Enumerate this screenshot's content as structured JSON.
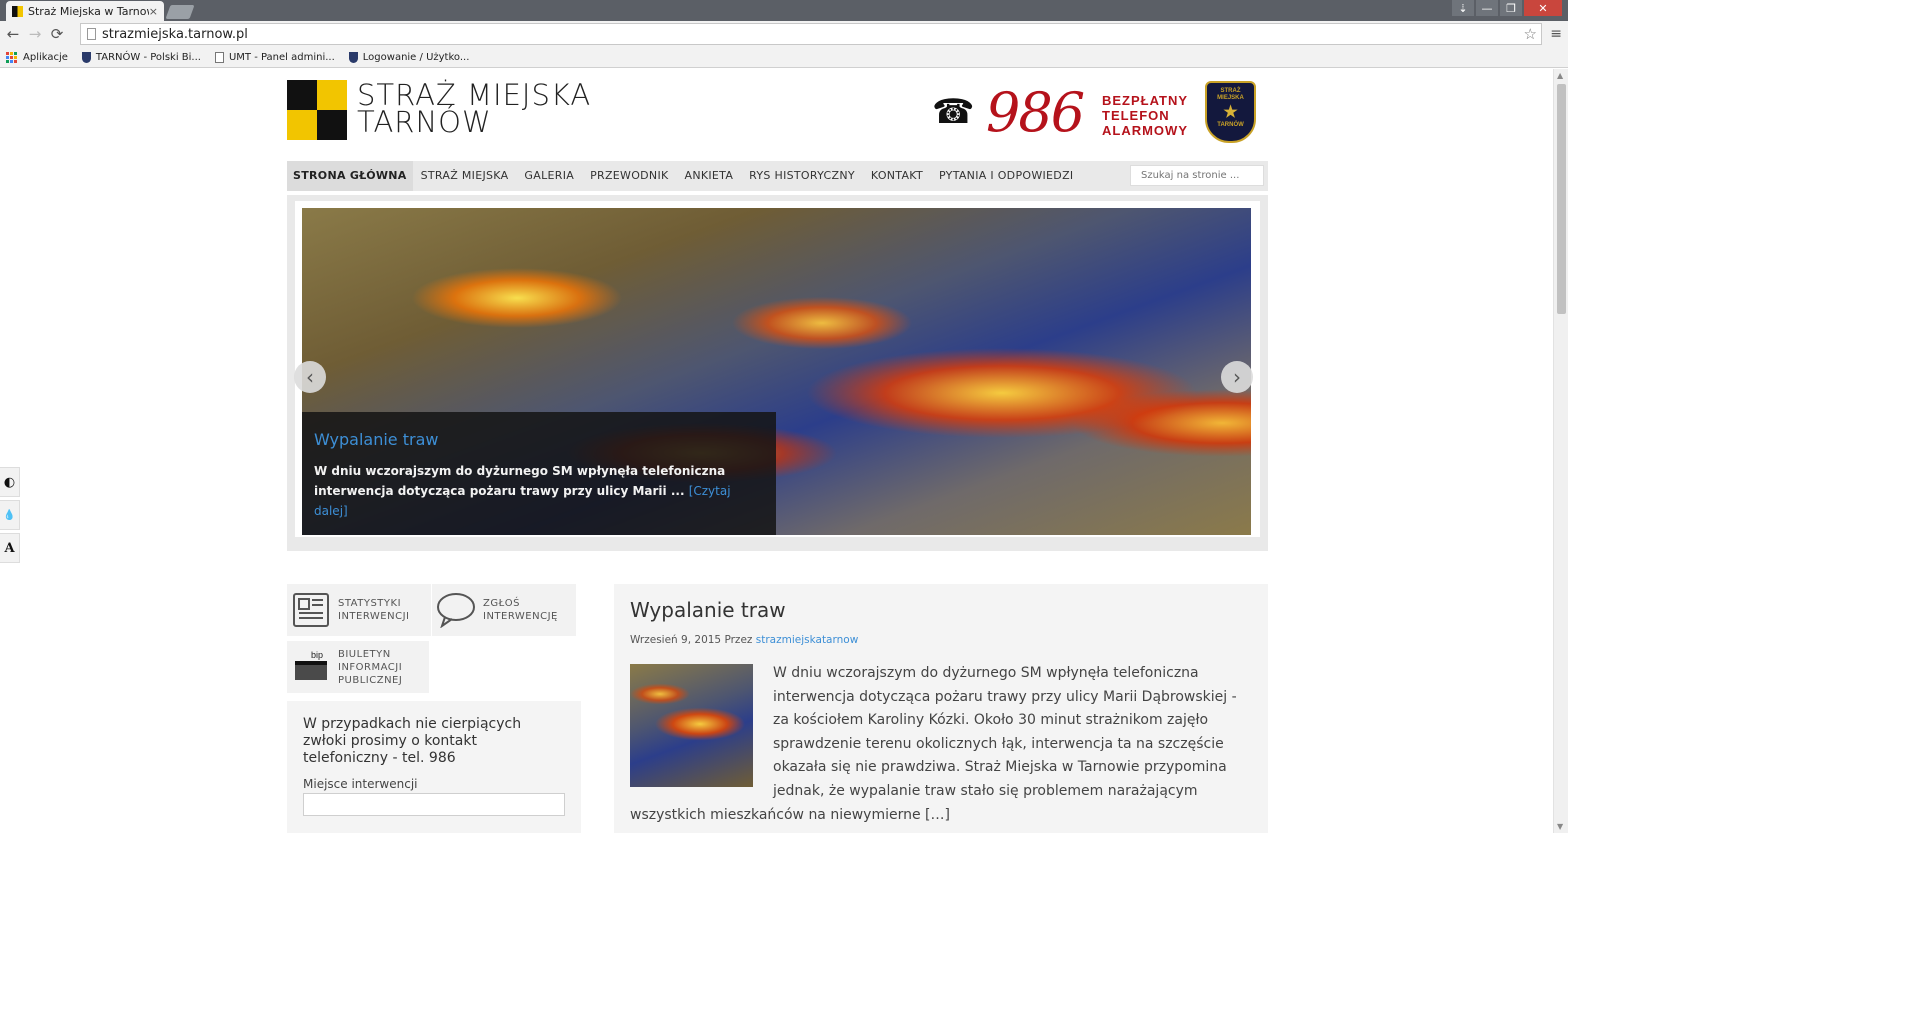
{
  "browser": {
    "tab_title": "Straż Miejska w Tarnowie",
    "tab_close": "×",
    "window_controls": [
      "⇣",
      "—",
      "❐",
      "✕"
    ],
    "nav": {
      "back": "←",
      "forward": "→",
      "reload": "⟳"
    },
    "url": "strazmiejska.tarnow.pl",
    "star": "☆",
    "menu": "≡",
    "bookmarks": [
      "Aplikacje",
      "TARNÓW - Polski Bi...",
      "UMT - Panel admini...",
      "Logowanie / Użytko..."
    ]
  },
  "colors": {
    "accent": "#3d8fd6",
    "alarm_red": "#b5121b",
    "logo_yellow": "#f2c500",
    "logo_black": "#111111"
  },
  "header": {
    "logo_line1": "STRAŻ MIEJSKA",
    "logo_line2": "TARNÓW",
    "phone_icon": "phone-icon",
    "alarm_number": "986",
    "alarm_words": [
      "BEZPŁATNY",
      "TELEFON",
      "ALARMOWY"
    ],
    "badge_top": "STRAŻ MIEJSKA",
    "badge_bottom": "TARNÓW"
  },
  "menu": {
    "items": [
      "STRONA GŁÓWNA",
      "STRAŻ MIEJSKA",
      "GALERIA",
      "PRZEWODNIK",
      "ANKIETA",
      "RYS HISTORYCZNY",
      "KONTAKT",
      "PYTANIA I ODPOWIEDZI"
    ],
    "search_placeholder": "Szukaj na stronie ..."
  },
  "slider": {
    "title": "Wypalanie traw",
    "text": "W dniu wczorajszym do dyżurnego SM wpłynęła telefoniczna interwencja dotycząca pożaru trawy przy ulicy Marii ...",
    "more": "[Czytaj dalej]",
    "prev": "‹",
    "next": "›"
  },
  "widgets": {
    "stats": [
      "STATYSTYKI",
      "INTERWENCJI"
    ],
    "report": [
      "ZGŁOŚ",
      "INTERWENCJĘ"
    ],
    "bip": [
      "BIULETYN",
      "INFORMACJI",
      "PUBLICZNEJ"
    ],
    "bip_logo": "bip"
  },
  "contact": {
    "note": "W przypadkach nie cierpiących zwłoki prosimy o kontakt telefoniczny - tel. 986",
    "location_label": "Miejsce interwencji",
    "location_value": ""
  },
  "article": {
    "title": "Wypalanie traw",
    "date": "Wrzesień 9, 2015",
    "by": "Przez",
    "author": "strazmiejskatarnow",
    "body": "W dniu wczorajszym do dyżurnego SM wpłynęła telefoniczna interwencja dotycząca pożaru trawy przy ulicy Marii Dąbrowskiej - za kościołem Karoliny Kózki. Około 30 minut strażnikom zajęło sprawdzenie terenu okolicznych łąk, interwencja ta na szczęście okazała się nie prawdziwa. Straż Miejska w Tarnowie przypomina jednak, że wypalanie traw stało się problemem narażającym wszystkich mieszkańców na niewymierne",
    "ellipsis": "[…]"
  },
  "accessibility": {
    "contrast": "◐",
    "ink": "💧",
    "font": "A"
  }
}
